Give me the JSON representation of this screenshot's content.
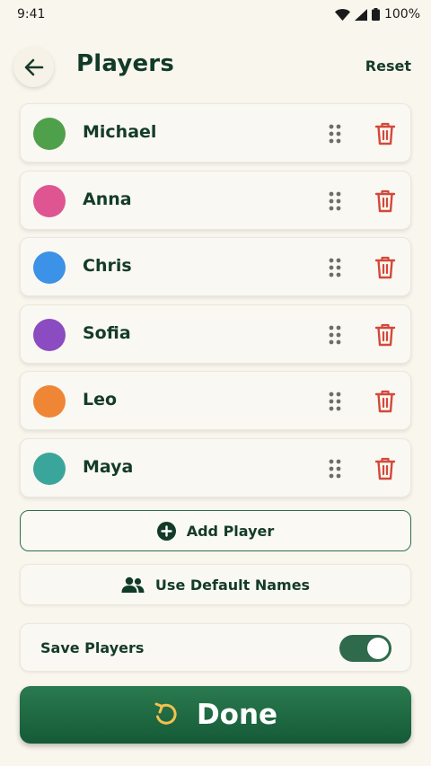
{
  "status_bar": {
    "time": "9:41",
    "battery": "100%"
  },
  "header": {
    "title": "Players",
    "reset_label": "Reset"
  },
  "players": [
    {
      "name": "Michael",
      "color": "#4fa04a"
    },
    {
      "name": "Anna",
      "color": "#de5591"
    },
    {
      "name": "Chris",
      "color": "#3b92e6"
    },
    {
      "name": "Sofia",
      "color": "#8a4cc0"
    },
    {
      "name": "Leo",
      "color": "#ef8636"
    },
    {
      "name": "Maya",
      "color": "#3aa69b"
    }
  ],
  "actions": {
    "add_player_label": "Add Player",
    "use_defaults_label": "Use Default Names"
  },
  "settings": {
    "save_players_label": "Save Players",
    "save_players_on": true
  },
  "done": {
    "label": "Done"
  },
  "colors": {
    "brand_green": "#1e6a44",
    "delete_red": "#d2493b",
    "background": "#f9f6ee"
  },
  "icons": {
    "back": "arrow-left-icon",
    "drag": "drag-handle-icon",
    "delete": "trash-icon",
    "add": "plus-circle-icon",
    "defaults": "people-icon",
    "done": "rotate-icon"
  }
}
